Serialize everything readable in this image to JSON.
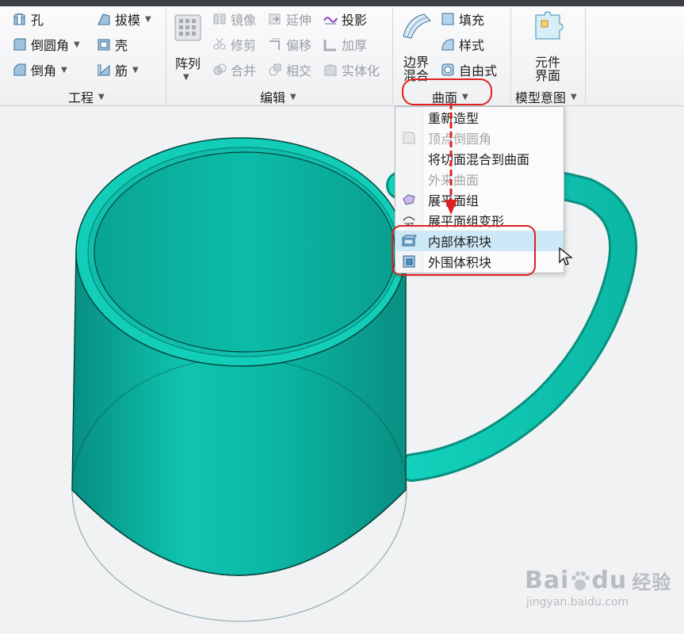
{
  "ribbon": {
    "engineering": {
      "hole": "孔",
      "round": "倒圆角",
      "chamfer": "倒角",
      "draft": "拔模",
      "shell": "壳",
      "rib": "筋",
      "group_label": "工程"
    },
    "edit": {
      "pattern": "阵列",
      "mirror": "镜像",
      "trim": "修剪",
      "merge": "合并",
      "extend": "延伸",
      "offset": "偏移",
      "intersect": "相交",
      "project": "投影",
      "thicken": "加厚",
      "solidify": "实体化",
      "group_label": "编辑"
    },
    "surfaces": {
      "boundary_blend_line1": "边界",
      "boundary_blend_line2": "混合",
      "fill": "填充",
      "style": "样式",
      "freestyle": "自由式",
      "group_label": "曲面"
    },
    "model_intent": {
      "component_interface_line1": "元件",
      "component_interface_line2": "界面",
      "group_label": "模型意图"
    }
  },
  "surface_menu": {
    "items": [
      {
        "label": "重新造型",
        "enabled": true,
        "icon": "none"
      },
      {
        "label": "顶点倒圆角",
        "enabled": false,
        "icon": "vertex-round-icon"
      },
      {
        "label": "将切面混合到曲面",
        "enabled": true,
        "icon": "none"
      },
      {
        "label": "外来曲面",
        "enabled": false,
        "icon": "none"
      },
      {
        "label": "展平面组",
        "enabled": true,
        "icon": "flatten-quilt-icon"
      },
      {
        "label": "展平面组变形",
        "enabled": true,
        "icon": "flatten-deform-icon"
      },
      {
        "label": "内部体积块",
        "enabled": true,
        "icon": "inner-volume-icon",
        "highlighted": true
      },
      {
        "label": "外围体积块",
        "enabled": true,
        "icon": "outer-volume-icon"
      }
    ]
  },
  "watermark": {
    "brand": "Bai",
    "brand2": "du",
    "cn": "经验",
    "url": "jingyan.baidu.com"
  },
  "colors": {
    "mug": "#0cc1ad",
    "annotation": "#e02020",
    "menu_highlight": "#cde8f6"
  }
}
